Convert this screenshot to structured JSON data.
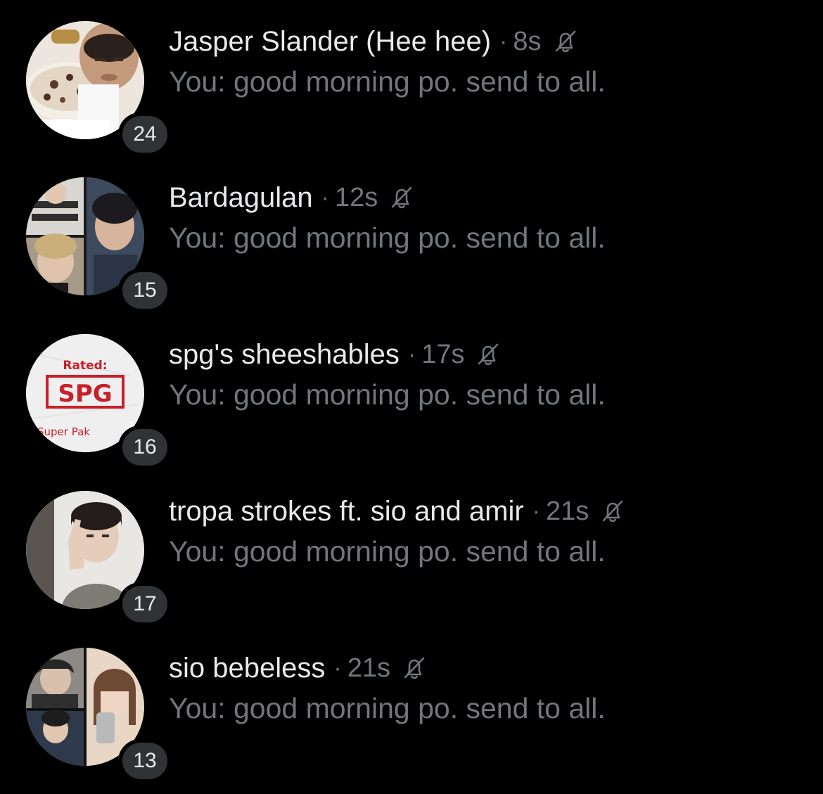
{
  "conversations": [
    {
      "name": "Jasper Slander (Hee hee)",
      "separator": "·",
      "time": "8s",
      "preview": "You: good morning po. send to all.",
      "count": "24",
      "avatar_icon": "group-avatar-photo",
      "muted_icon": "bell-off-icon"
    },
    {
      "name": "Bardagulan",
      "separator": "·",
      "time": "12s",
      "preview": "You: good morning po. send to all.",
      "count": "15",
      "avatar_icon": "group-avatar-collage",
      "muted_icon": "bell-off-icon"
    },
    {
      "name": "spg's sheeshables",
      "separator": "·",
      "time": "17s",
      "preview": "You: good morning po. send to all.",
      "count": "16",
      "avatar_icon": "group-avatar-logo",
      "avatar_text": {
        "rated": "Rated:",
        "logo": "SPG",
        "sub": "Super Pak"
      },
      "muted_icon": "bell-off-icon"
    },
    {
      "name": "tropa strokes ft. sio and amir",
      "separator": "·",
      "time": "21s",
      "preview": "You: good morning po. send to all.",
      "count": "17",
      "avatar_icon": "group-avatar-photo",
      "muted_icon": "bell-off-icon"
    },
    {
      "name": "sio bebeless",
      "separator": "·",
      "time": "21s",
      "preview": "You: good morning po. send to all.",
      "count": "13",
      "avatar_icon": "group-avatar-collage",
      "muted_icon": "bell-off-icon"
    }
  ],
  "colors": {
    "background": "#000000",
    "primary_text": "#e7e9ea",
    "secondary_text": "#71767b",
    "badge_fill": "#2f3336",
    "logo_red": "#c8202a"
  }
}
